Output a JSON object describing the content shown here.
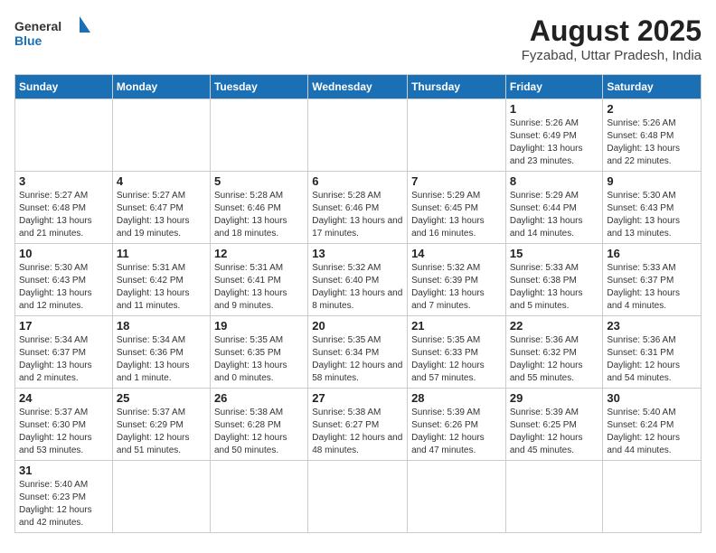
{
  "logo": {
    "general": "General",
    "blue": "Blue"
  },
  "title": "August 2025",
  "subtitle": "Fyzabad, Uttar Pradesh, India",
  "days_of_week": [
    "Sunday",
    "Monday",
    "Tuesday",
    "Wednesday",
    "Thursday",
    "Friday",
    "Saturday"
  ],
  "weeks": [
    [
      {
        "day": "",
        "info": ""
      },
      {
        "day": "",
        "info": ""
      },
      {
        "day": "",
        "info": ""
      },
      {
        "day": "",
        "info": ""
      },
      {
        "day": "",
        "info": ""
      },
      {
        "day": "1",
        "info": "Sunrise: 5:26 AM\nSunset: 6:49 PM\nDaylight: 13 hours and 23 minutes."
      },
      {
        "day": "2",
        "info": "Sunrise: 5:26 AM\nSunset: 6:48 PM\nDaylight: 13 hours and 22 minutes."
      }
    ],
    [
      {
        "day": "3",
        "info": "Sunrise: 5:27 AM\nSunset: 6:48 PM\nDaylight: 13 hours and 21 minutes."
      },
      {
        "day": "4",
        "info": "Sunrise: 5:27 AM\nSunset: 6:47 PM\nDaylight: 13 hours and 19 minutes."
      },
      {
        "day": "5",
        "info": "Sunrise: 5:28 AM\nSunset: 6:46 PM\nDaylight: 13 hours and 18 minutes."
      },
      {
        "day": "6",
        "info": "Sunrise: 5:28 AM\nSunset: 6:46 PM\nDaylight: 13 hours and 17 minutes."
      },
      {
        "day": "7",
        "info": "Sunrise: 5:29 AM\nSunset: 6:45 PM\nDaylight: 13 hours and 16 minutes."
      },
      {
        "day": "8",
        "info": "Sunrise: 5:29 AM\nSunset: 6:44 PM\nDaylight: 13 hours and 14 minutes."
      },
      {
        "day": "9",
        "info": "Sunrise: 5:30 AM\nSunset: 6:43 PM\nDaylight: 13 hours and 13 minutes."
      }
    ],
    [
      {
        "day": "10",
        "info": "Sunrise: 5:30 AM\nSunset: 6:43 PM\nDaylight: 13 hours and 12 minutes."
      },
      {
        "day": "11",
        "info": "Sunrise: 5:31 AM\nSunset: 6:42 PM\nDaylight: 13 hours and 11 minutes."
      },
      {
        "day": "12",
        "info": "Sunrise: 5:31 AM\nSunset: 6:41 PM\nDaylight: 13 hours and 9 minutes."
      },
      {
        "day": "13",
        "info": "Sunrise: 5:32 AM\nSunset: 6:40 PM\nDaylight: 13 hours and 8 minutes."
      },
      {
        "day": "14",
        "info": "Sunrise: 5:32 AM\nSunset: 6:39 PM\nDaylight: 13 hours and 7 minutes."
      },
      {
        "day": "15",
        "info": "Sunrise: 5:33 AM\nSunset: 6:38 PM\nDaylight: 13 hours and 5 minutes."
      },
      {
        "day": "16",
        "info": "Sunrise: 5:33 AM\nSunset: 6:37 PM\nDaylight: 13 hours and 4 minutes."
      }
    ],
    [
      {
        "day": "17",
        "info": "Sunrise: 5:34 AM\nSunset: 6:37 PM\nDaylight: 13 hours and 2 minutes."
      },
      {
        "day": "18",
        "info": "Sunrise: 5:34 AM\nSunset: 6:36 PM\nDaylight: 13 hours and 1 minute."
      },
      {
        "day": "19",
        "info": "Sunrise: 5:35 AM\nSunset: 6:35 PM\nDaylight: 13 hours and 0 minutes."
      },
      {
        "day": "20",
        "info": "Sunrise: 5:35 AM\nSunset: 6:34 PM\nDaylight: 12 hours and 58 minutes."
      },
      {
        "day": "21",
        "info": "Sunrise: 5:35 AM\nSunset: 6:33 PM\nDaylight: 12 hours and 57 minutes."
      },
      {
        "day": "22",
        "info": "Sunrise: 5:36 AM\nSunset: 6:32 PM\nDaylight: 12 hours and 55 minutes."
      },
      {
        "day": "23",
        "info": "Sunrise: 5:36 AM\nSunset: 6:31 PM\nDaylight: 12 hours and 54 minutes."
      }
    ],
    [
      {
        "day": "24",
        "info": "Sunrise: 5:37 AM\nSunset: 6:30 PM\nDaylight: 12 hours and 53 minutes."
      },
      {
        "day": "25",
        "info": "Sunrise: 5:37 AM\nSunset: 6:29 PM\nDaylight: 12 hours and 51 minutes."
      },
      {
        "day": "26",
        "info": "Sunrise: 5:38 AM\nSunset: 6:28 PM\nDaylight: 12 hours and 50 minutes."
      },
      {
        "day": "27",
        "info": "Sunrise: 5:38 AM\nSunset: 6:27 PM\nDaylight: 12 hours and 48 minutes."
      },
      {
        "day": "28",
        "info": "Sunrise: 5:39 AM\nSunset: 6:26 PM\nDaylight: 12 hours and 47 minutes."
      },
      {
        "day": "29",
        "info": "Sunrise: 5:39 AM\nSunset: 6:25 PM\nDaylight: 12 hours and 45 minutes."
      },
      {
        "day": "30",
        "info": "Sunrise: 5:40 AM\nSunset: 6:24 PM\nDaylight: 12 hours and 44 minutes."
      }
    ],
    [
      {
        "day": "31",
        "info": "Sunrise: 5:40 AM\nSunset: 6:23 PM\nDaylight: 12 hours and 42 minutes."
      },
      {
        "day": "",
        "info": ""
      },
      {
        "day": "",
        "info": ""
      },
      {
        "day": "",
        "info": ""
      },
      {
        "day": "",
        "info": ""
      },
      {
        "day": "",
        "info": ""
      },
      {
        "day": "",
        "info": ""
      }
    ]
  ]
}
